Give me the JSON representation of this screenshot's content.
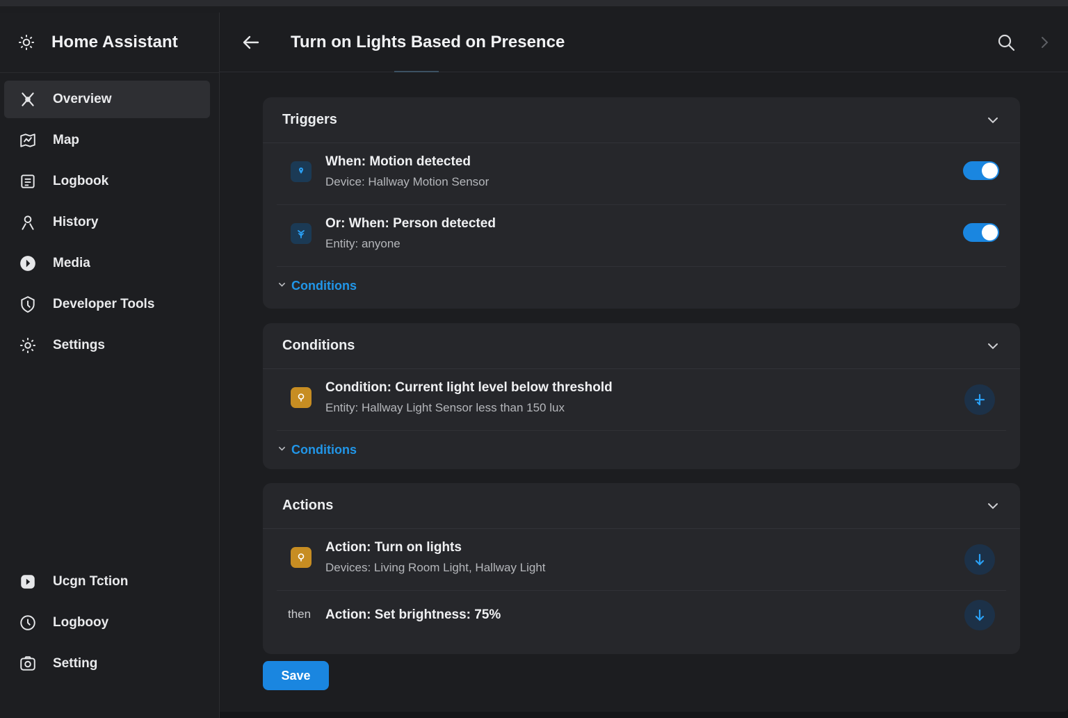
{
  "app": {
    "title": "Home Assistant"
  },
  "sidebar": {
    "items": [
      {
        "label": "Overview",
        "icon": "overview-icon"
      },
      {
        "label": "Map",
        "icon": "map-icon"
      },
      {
        "label": "Logbook",
        "icon": "logbook-icon"
      },
      {
        "label": "History",
        "icon": "history-icon"
      },
      {
        "label": "Media",
        "icon": "media-icon"
      },
      {
        "label": "Developer Tools",
        "icon": "developer-tools-icon"
      },
      {
        "label": "Settings",
        "icon": "settings-icon"
      }
    ],
    "bottom_items": [
      {
        "label": "Ucgn Tction",
        "icon": "app-icon"
      },
      {
        "label": "Logbooy",
        "icon": "logbook-icon"
      },
      {
        "label": "Setting",
        "icon": "settings-icon"
      }
    ]
  },
  "header": {
    "title": "Turn on Lights Based on Presence"
  },
  "triggers": {
    "title": "Triggers",
    "rows": [
      {
        "title": "When: Motion detected",
        "subtitle": "Device: Hallway Motion Sensor",
        "enabled": true
      },
      {
        "title": "Or: When: Person detected",
        "subtitle": "Entity: anyone",
        "enabled": true
      }
    ],
    "link_label": "Conditions"
  },
  "conditions": {
    "title": "Conditions",
    "rows": [
      {
        "title": "Condition: Current light level below threshold",
        "subtitle": "Entity: Hallway Light Sensor less than 150 lux"
      }
    ],
    "link_label": "Conditions"
  },
  "actions": {
    "title": "Actions",
    "rows": [
      {
        "title": "Action: Turn on lights",
        "subtitle": "Devices: Living Room Light, Hallway Light"
      },
      {
        "prefix": "then",
        "title": "Action:  Set brightness: 75%"
      }
    ]
  },
  "save_label": "Save",
  "colors": {
    "accent": "#1a86e0",
    "background": "#1c1d20",
    "card": "#26272b",
    "amber": "#c78d22"
  }
}
